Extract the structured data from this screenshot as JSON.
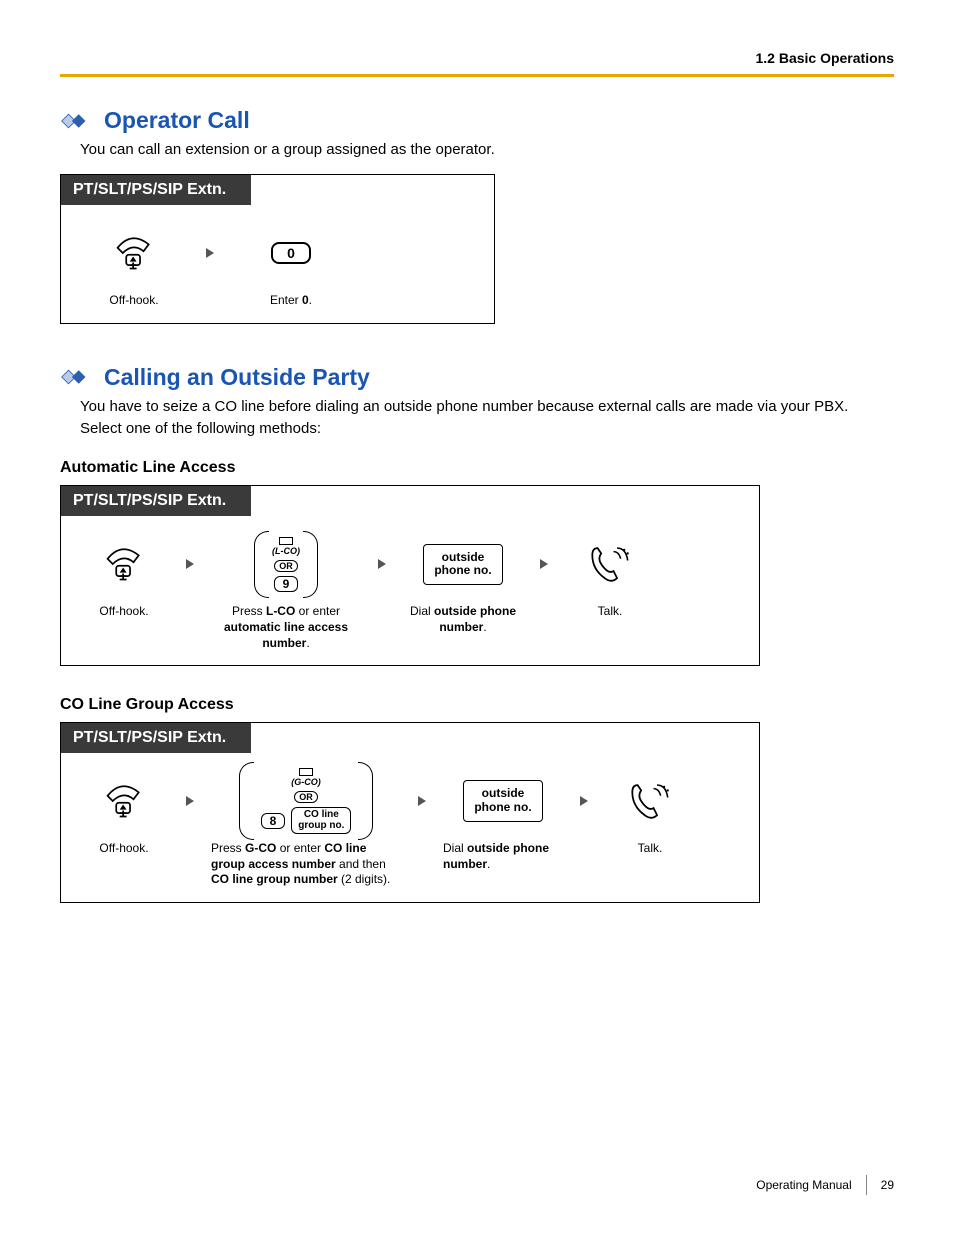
{
  "header": {
    "crumb": "1.2 Basic Operations"
  },
  "sec1": {
    "title": "Operator Call",
    "intro": "You can call an extension or a group assigned as the operator.",
    "tab": "PT/SLT/PS/SIP Extn.",
    "step1": "Off-hook.",
    "key": "0",
    "step2_pre": "Enter ",
    "step2_b": "0",
    "step2_post": "."
  },
  "sec2": {
    "title": "Calling an Outside Party",
    "intro": "You have to seize a CO line before dialing an outside phone number because external calls are made via your PBX.",
    "intro2": "Select one of the following methods:",
    "sub1": "Automatic Line Access",
    "tab1": "PT/SLT/PS/SIP Extn.",
    "t1": {
      "offhook": "Off-hook.",
      "lco_label": "(L-CO)",
      "or": "OR",
      "key": "9",
      "cap_pre": "Press ",
      "cap_b1": "L-CO",
      "cap_mid": " or enter ",
      "cap_b2": "automatic line access number",
      "cap_post": ".",
      "box_l1": "outside",
      "box_l2": "phone no.",
      "dial_pre": "Dial ",
      "dial_b": "outside phone number",
      "dial_post": ".",
      "talk": "Talk."
    },
    "sub2": "CO Line Group Access",
    "tab2": "PT/SLT/PS/SIP Extn.",
    "t2": {
      "offhook": "Off-hook.",
      "gco_label": "(G-CO)",
      "or": "OR",
      "key": "8",
      "key2_l1": "CO line",
      "key2_l2": "group no.",
      "cap_pre": "Press ",
      "cap_b1": "G-CO",
      "cap_mid": " or enter ",
      "cap_b2": "CO line group access number",
      "cap_mid2": " and then ",
      "cap_b3": "CO line group number",
      "cap_post": " (2 digits).",
      "box_l1": "outside",
      "box_l2": "phone no.",
      "dial_pre": "Dial ",
      "dial_b": "outside phone number",
      "dial_post": ".",
      "talk": "Talk."
    }
  },
  "footer": {
    "manual": "Operating Manual",
    "page": "29"
  }
}
